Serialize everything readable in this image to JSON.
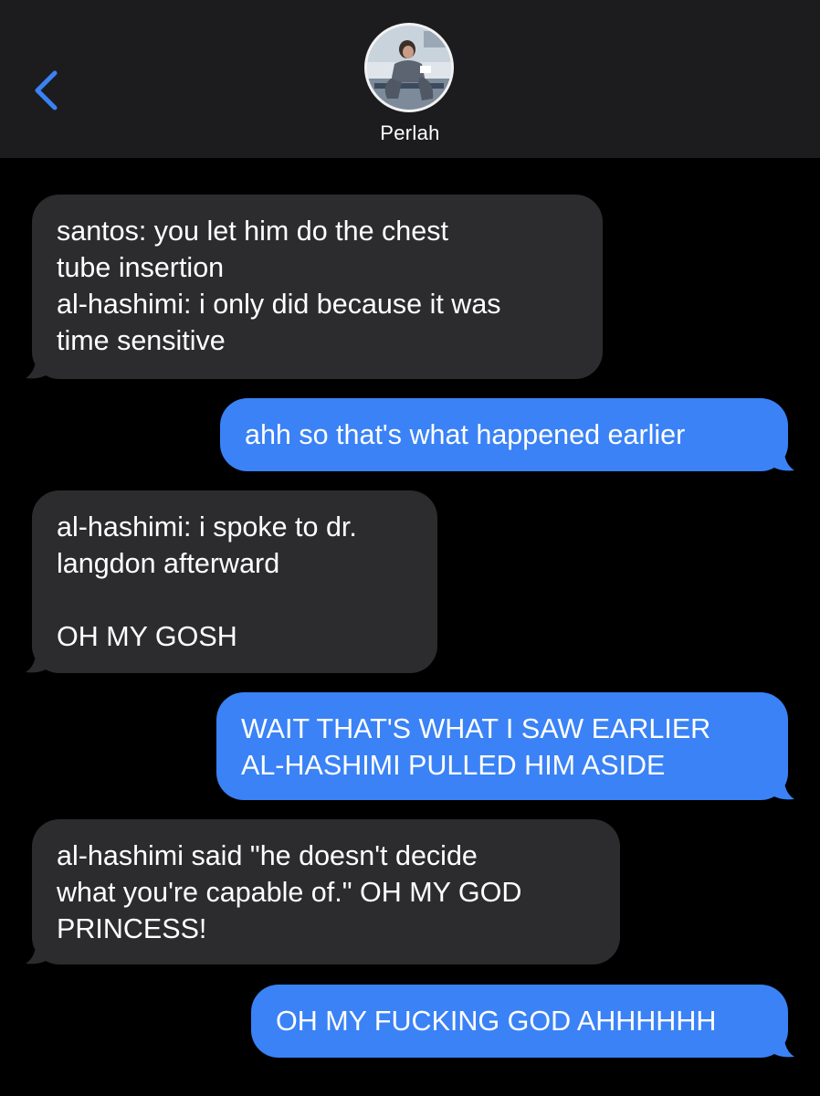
{
  "header": {
    "contact_name": "Perlah",
    "back_icon": "chevron-left-icon",
    "avatar": "contact-avatar-photo"
  },
  "colors": {
    "background": "#000000",
    "header_background": "#1c1c1e",
    "incoming_bubble": "#2c2c2e",
    "outgoing_bubble": "#3a82f6",
    "accent": "#3a82f6"
  },
  "messages": [
    {
      "direction": "incoming",
      "text": "santos: you let him do the chest\ntube insertion\nal-hashimi: i only did because it was\ntime sensitive"
    },
    {
      "direction": "outgoing",
      "text": "ahh so that's what happened earlier"
    },
    {
      "direction": "incoming",
      "text": "al-hashimi: i spoke to dr.\nlangdon afterward\n\nOH MY GOSH"
    },
    {
      "direction": "outgoing",
      "text": "WAIT THAT'S WHAT I SAW EARLIER\nAL-HASHIMI PULLED HIM ASIDE"
    },
    {
      "direction": "incoming",
      "text": "al-hashimi said \"he doesn't decide\nwhat you're capable of.\" OH MY GOD\nPRINCESS!"
    },
    {
      "direction": "outgoing",
      "text": "OH MY FUCKING GOD AHHHHHH"
    }
  ]
}
